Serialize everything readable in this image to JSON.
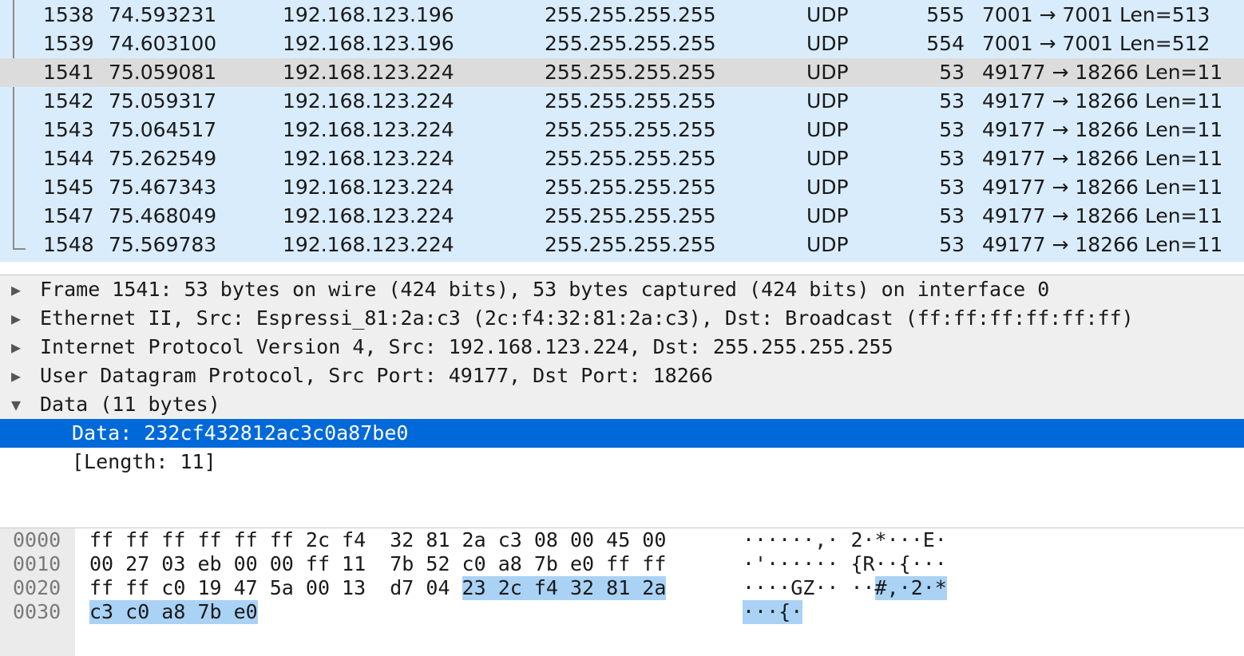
{
  "packet_list": [
    {
      "no": "1538",
      "time": "74.593231",
      "src": "192.168.123.196",
      "dst": "255.255.255.255",
      "proto": "UDP",
      "len": "555",
      "info": "7001 → 7001 Len=513",
      "selected": false
    },
    {
      "no": "1539",
      "time": "74.603100",
      "src": "192.168.123.196",
      "dst": "255.255.255.255",
      "proto": "UDP",
      "len": "554",
      "info": "7001 → 7001 Len=512",
      "selected": false
    },
    {
      "no": "1541",
      "time": "75.059081",
      "src": "192.168.123.224",
      "dst": "255.255.255.255",
      "proto": "UDP",
      "len": "53",
      "info": "49177 → 18266 Len=11",
      "selected": true
    },
    {
      "no": "1542",
      "time": "75.059317",
      "src": "192.168.123.224",
      "dst": "255.255.255.255",
      "proto": "UDP",
      "len": "53",
      "info": "49177 → 18266 Len=11",
      "selected": false
    },
    {
      "no": "1543",
      "time": "75.064517",
      "src": "192.168.123.224",
      "dst": "255.255.255.255",
      "proto": "UDP",
      "len": "53",
      "info": "49177 → 18266 Len=11",
      "selected": false
    },
    {
      "no": "1544",
      "time": "75.262549",
      "src": "192.168.123.224",
      "dst": "255.255.255.255",
      "proto": "UDP",
      "len": "53",
      "info": "49177 → 18266 Len=11",
      "selected": false
    },
    {
      "no": "1545",
      "time": "75.467343",
      "src": "192.168.123.224",
      "dst": "255.255.255.255",
      "proto": "UDP",
      "len": "53",
      "info": "49177 → 18266 Len=11",
      "selected": false
    },
    {
      "no": "1547",
      "time": "75.468049",
      "src": "192.168.123.224",
      "dst": "255.255.255.255",
      "proto": "UDP",
      "len": "53",
      "info": "49177 → 18266 Len=11",
      "selected": false
    },
    {
      "no": "1548",
      "time": "75.569783",
      "src": "192.168.123.224",
      "dst": "255.255.255.255",
      "proto": "UDP",
      "len": "53",
      "info": "49177 → 18266 Len=11",
      "selected": false
    }
  ],
  "details": [
    {
      "text": "Frame 1541: 53 bytes on wire (424 bits), 53 bytes captured (424 bits) on interface 0",
      "expander": "collapsed",
      "depth": 0,
      "highlight": false
    },
    {
      "text": "Ethernet II, Src: Espressi_81:2a:c3 (2c:f4:32:81:2a:c3), Dst: Broadcast (ff:ff:ff:ff:ff:ff)",
      "expander": "collapsed",
      "depth": 0,
      "highlight": false
    },
    {
      "text": "Internet Protocol Version 4, Src: 192.168.123.224, Dst: 255.255.255.255",
      "expander": "collapsed",
      "depth": 0,
      "highlight": false
    },
    {
      "text": "User Datagram Protocol, Src Port: 49177, Dst Port: 18266",
      "expander": "collapsed",
      "depth": 0,
      "highlight": false
    },
    {
      "text": "Data (11 bytes)",
      "expander": "expanded",
      "depth": 0,
      "highlight": false
    },
    {
      "text": "Data: 232cf432812ac3c0a87be0",
      "expander": "none",
      "depth": 1,
      "highlight": true
    },
    {
      "text": "[Length: 11]",
      "expander": "none",
      "depth": 1,
      "highlight": false
    }
  ],
  "icons": {
    "collapsed": "triangle-right-icon",
    "expanded": "triangle-down-icon"
  },
  "hex_dump": [
    {
      "offset": "0000",
      "bytes": [
        "ff",
        "ff",
        "ff",
        "ff",
        "ff",
        "ff",
        "2c",
        "f4",
        "32",
        "81",
        "2a",
        "c3",
        "08",
        "00",
        "45",
        "00"
      ],
      "ascii": [
        "·",
        "·",
        "·",
        "·",
        "·",
        "·",
        ",",
        "·",
        "2",
        "·",
        "*",
        "·",
        "·",
        "·",
        "E",
        "·"
      ],
      "highlight_from": 16
    },
    {
      "offset": "0010",
      "bytes": [
        "00",
        "27",
        "03",
        "eb",
        "00",
        "00",
        "ff",
        "11",
        "7b",
        "52",
        "c0",
        "a8",
        "7b",
        "e0",
        "ff",
        "ff"
      ],
      "ascii": [
        "·",
        "'",
        "·",
        "·",
        "·",
        "·",
        "·",
        "·",
        "{",
        "R",
        "·",
        "·",
        "{",
        "·",
        "·",
        "·"
      ],
      "highlight_from": 16
    },
    {
      "offset": "0020",
      "bytes": [
        "ff",
        "ff",
        "c0",
        "19",
        "47",
        "5a",
        "00",
        "13",
        "d7",
        "04",
        "23",
        "2c",
        "f4",
        "32",
        "81",
        "2a"
      ],
      "ascii": [
        "·",
        "·",
        "·",
        "·",
        "G",
        "Z",
        "·",
        "·",
        "·",
        "·",
        "#",
        ",",
        "·",
        "2",
        "·",
        "*"
      ],
      "highlight_from": 10
    },
    {
      "offset": "0030",
      "bytes": [
        "c3",
        "c0",
        "a8",
        "7b",
        "e0"
      ],
      "ascii": [
        "·",
        "·",
        "·",
        "{",
        "·"
      ],
      "highlight_from": 0
    }
  ],
  "colors": {
    "packet_bg": "#d9ecfc",
    "selected_row": "#dcdcdc",
    "detail_highlight": "#0069d9",
    "byte_highlight": "#a9d2f5"
  }
}
